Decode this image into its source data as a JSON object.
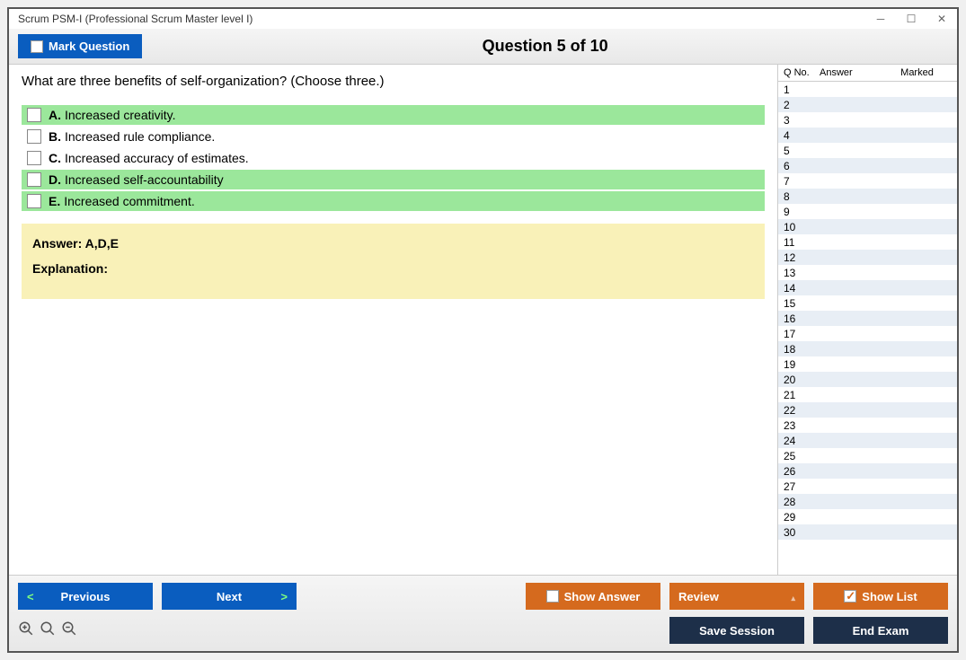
{
  "window": {
    "title": "Scrum PSM-I (Professional Scrum Master level I)"
  },
  "header": {
    "mark_label": "Mark Question",
    "question_title": "Question 5 of 10"
  },
  "question": {
    "text": "What are three benefits of self-organization? (Choose three.)",
    "options": [
      {
        "letter": "A.",
        "text": "Increased creativity.",
        "correct": true
      },
      {
        "letter": "B.",
        "text": "Increased rule compliance.",
        "correct": false
      },
      {
        "letter": "C.",
        "text": "Increased accuracy of estimates.",
        "correct": false
      },
      {
        "letter": "D.",
        "text": "Increased self-accountability",
        "correct": true
      },
      {
        "letter": "E.",
        "text": "Increased commitment.",
        "correct": true
      }
    ],
    "answer_line": "Answer: A,D,E",
    "explanation_label": "Explanation:"
  },
  "sidebar": {
    "headers": {
      "qno": "Q No.",
      "answer": "Answer",
      "marked": "Marked"
    },
    "rows": [
      1,
      2,
      3,
      4,
      5,
      6,
      7,
      8,
      9,
      10,
      11,
      12,
      13,
      14,
      15,
      16,
      17,
      18,
      19,
      20,
      21,
      22,
      23,
      24,
      25,
      26,
      27,
      28,
      29,
      30
    ]
  },
  "footer": {
    "previous": "Previous",
    "next": "Next",
    "show_answer": "Show Answer",
    "review": "Review",
    "show_list": "Show List",
    "save_session": "Save Session",
    "end_exam": "End Exam"
  }
}
